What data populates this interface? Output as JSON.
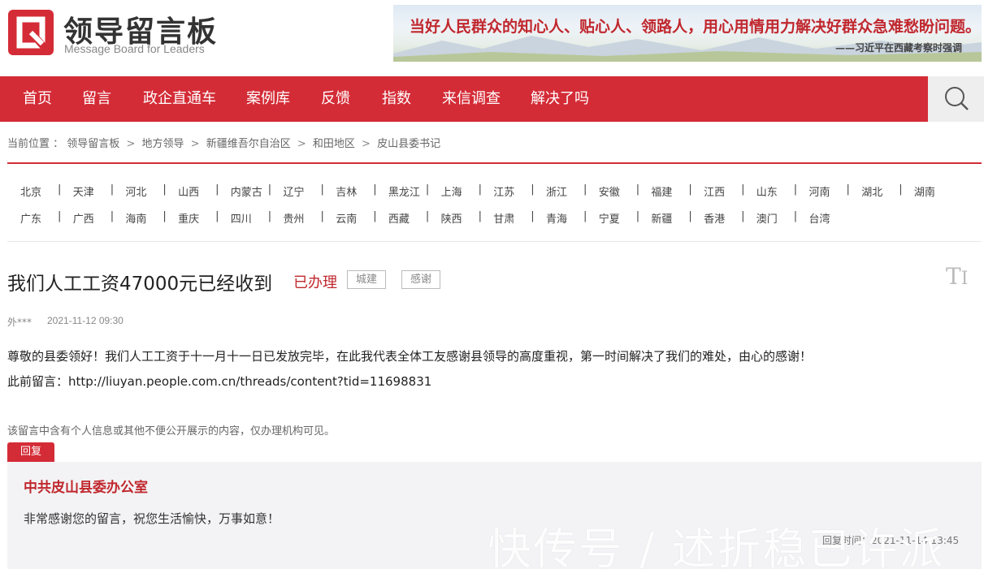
{
  "brand": {
    "title": "领导留言板",
    "subtitle": "Message Board for Leaders",
    "logo_color": "#d42c37"
  },
  "banner": {
    "quote": "当好人民群众的知心人、贴心人、领路人，用心用情用力解决好群众急难愁盼问题。",
    "signature": "——习近平在西藏考察时强调"
  },
  "nav": {
    "items": [
      "首页",
      "留言",
      "政企直通车",
      "案例库",
      "反馈",
      "指数",
      "来信调查",
      "解决了吗"
    ],
    "search_icon": "search-icon",
    "bg_color": "#d42c37"
  },
  "breadcrumb": {
    "label": "当前位置 ：",
    "items": [
      "领导留言板",
      "地方领导",
      "新疆维吾尔自治区",
      "和田地区",
      "皮山县委书记"
    ],
    "separator": ">"
  },
  "regions": {
    "row1": [
      "北京",
      "天津",
      "河北",
      "山西",
      "内蒙古",
      "辽宁",
      "吉林",
      "黑龙江",
      "上海",
      "江苏",
      "浙江",
      "安徽",
      "福建",
      "江西",
      "山东",
      "河南",
      "湖北",
      "湖南"
    ],
    "row2": [
      "广东",
      "广西",
      "海南",
      "重庆",
      "四川",
      "贵州",
      "云南",
      "西藏",
      "陕西",
      "甘肃",
      "青海",
      "宁夏",
      "新疆",
      "香港",
      "澳门",
      "台湾"
    ],
    "separator": "|"
  },
  "message": {
    "title": "我们人工工资47000元已经收到",
    "status": "已办理",
    "tags": [
      "城建",
      "感谢"
    ],
    "font_toggle": "TI",
    "user": "外***",
    "time": "2021-11-12 09:30",
    "body": "尊敬的县委领好！我们人工工资于十一月十一日已发放完毕，在此我代表全体工友感谢县领导的高度重视，第一时间解决了我们的难处，由心的感谢！",
    "previous": "此前留言：http://liuyan.people.com.cn/threads/content?tid=11698831",
    "notice": "该留言中含有个人信息或其他不便公开展示的内容，仅办理机构可见。"
  },
  "reply": {
    "tab_label": "回复",
    "org": "中共皮山县委办公室",
    "text": "非常感谢您的留言，祝您生活愉快，万事如意！",
    "time": "回复时间：2021-11-14 13:45"
  },
  "watermark": "快传号 / 述折稳已许派"
}
